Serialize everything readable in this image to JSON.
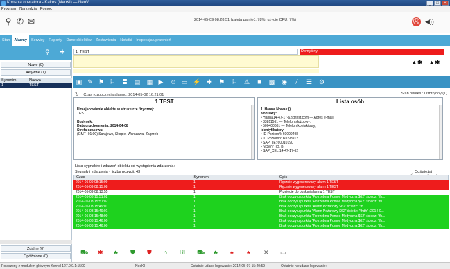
{
  "window": {
    "title": "Konsola operatora - Kairos (NeoKI) — NeoV"
  },
  "menu": [
    "Program",
    "Narzędzia",
    "Pomoc"
  ],
  "status_top": "2014-05-09 08:28:51 (zajęta pamięć: 78%, użycie CPU: 7%)",
  "nav": [
    "Stan",
    "Alarmy",
    "Serwisy",
    "Raporty",
    "Dane obiektów",
    "Zestawienia",
    "Notatki",
    "Inspekcja uprawnień"
  ],
  "left": {
    "new_label": "Nowe (0)",
    "active_label": "Aktywne (1)",
    "columns": [
      "Synonim",
      "Nazwa"
    ],
    "rows": [
      [
        "1",
        "TEST"
      ]
    ],
    "done_label": "Zdalne (0)",
    "postponed_label": "Opóźnione (0)"
  },
  "alarm": {
    "id": "1, TEST",
    "type": "Domyślny"
  },
  "time_line": "Czas rozpoczęcia alarmu: 2014-05-02 16:21:01",
  "object_state": "Stan obiektu: Uzbrojony (1)",
  "panel_left": {
    "title": "1 TEST",
    "lines": [
      {
        "t": "Umiejscowienie obiektu w strukturze fizycznej:",
        "b": true
      },
      {
        "t": "TEST",
        "b": false
      },
      {
        "t": "",
        "b": false
      },
      {
        "t": "Budynek:",
        "b": true
      },
      {
        "t": "Data uruchomienia: 2014-04-08",
        "b": true
      },
      {
        "t": "Strefa czasowa:",
        "b": true
      },
      {
        "t": "(GMT+01:00) Sarajewo, Skopje, Warszawa, Zagrzeb",
        "b": false
      }
    ]
  },
  "panel_right": {
    "title": "Lista osób",
    "lines": [
      {
        "t": "1. Hanna Nowak ()",
        "b": true
      },
      {
        "t": "Kontakty:",
        "b": true
      },
      {
        "t": "• Hanna14-47-17-62@test.com — Adres e-mail;",
        "b": false
      },
      {
        "t": "• 33811561 — Telefon służbowy;",
        "b": false
      },
      {
        "t": "• 500400661 — Telefon kontaktowy;",
        "b": false
      },
      {
        "t": "Identyfikatory:",
        "b": true
      },
      {
        "t": "• ID Poziom4: 60099498",
        "b": false
      },
      {
        "t": "• ID Poziom3: 60098912",
        "b": false
      },
      {
        "t": "• SAP_JE: 60010190",
        "b": false
      },
      {
        "t": "• NOWY_ID: B",
        "b": false
      },
      {
        "t": "• SAP_CEL 14-47-17-62",
        "b": false
      }
    ]
  },
  "signals": {
    "title": "Lista sygnałów i zdarzeń obiektu od wystąpienia zdarzenia:",
    "count": "Sygnały i zdarzenia - liczba pozycji: 43",
    "auto_refresh": "Odświeżaj automatycznie",
    "columns": [
      "Czas",
      "Synonim",
      "Opis"
    ],
    "rows": [
      {
        "c": "red",
        "t": "2014-05-09 08:15:09",
        "s": "1",
        "d": "Ręcznie wygenerowany alarm 1 TEST"
      },
      {
        "c": "red",
        "t": "2014-05-09 08:15:08",
        "s": "1",
        "d": "Ręcznie wygenerowany alarm 1 TEST"
      },
      {
        "c": "white",
        "t": "2014-05-09 08:13:55",
        "s": "1",
        "d": "Przejęcie do obsługi alarmu 1 TEST"
      },
      {
        "c": "green",
        "t": "2014-05-03 15:51:02",
        "s": "1",
        "d": "Brak odczytu punktu \"Potrzebna Pomoc Medyczna $62\" ściedz: \"fh..."
      },
      {
        "c": "green",
        "t": "2014-05-03 15:51:02",
        "s": "1",
        "d": "Brak odczytu punktu \"Potrzebna Pomoc Medyczna $62\" ściedz: \"fh..."
      },
      {
        "c": "green",
        "t": "2014-05-03 15:49:01",
        "s": "1",
        "d": "Brak odczytu punktu \"Alarm Pożarowy $62\" ściedz: \"fh..."
      },
      {
        "c": "green",
        "t": "2014-05-03 15:49:01",
        "s": "1",
        "d": "Brak odczytu punktu \"Alarm Pożarowy $62\" ściedz: \"fhdh\" (2014-0..."
      },
      {
        "c": "green",
        "t": "2014-05-03 15:48:00",
        "s": "1",
        "d": "Brak odczytu punktu \"Potrzebna Pomoc Medyczna $62\" ściedz: \"fh..."
      },
      {
        "c": "green",
        "t": "2014-05-03 15:46:00",
        "s": "1",
        "d": "Brak odczytu punktu \"Potrzebna Pomoc Medyczna $62\" ściedz: \"fh..."
      },
      {
        "c": "green",
        "t": "2014-05-03 15:46:00",
        "s": "1",
        "d": "Brak odczytu punktu \"Potrzebna Pomoc Medyczna $62\" ściedz: \"fh..."
      }
    ]
  },
  "statusbar": {
    "connection": "Połączony z modułem głównym Kernel 127.0.0.1:1500",
    "user": "NeoKI",
    "last_login": "Ostatnie udane logowanie: 2014-05-07 15:40:59",
    "last_failed": "Ostatnie nieudane logowanie: -"
  },
  "colors": {
    "accent": "#4da9d6",
    "strip": "#3a93c4",
    "alarm_red": "#ee1c1c",
    "ok_green": "#1ed21e"
  }
}
